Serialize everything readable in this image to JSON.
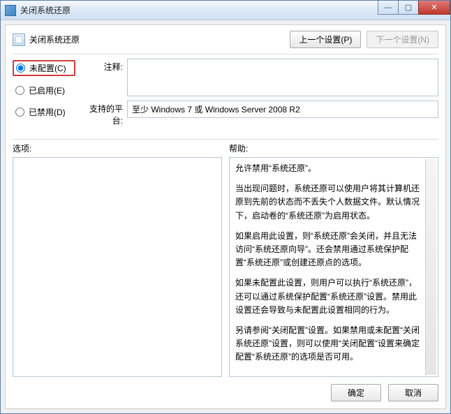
{
  "window_title": "关闭系统还原",
  "header": {
    "title": "关闭系统还原"
  },
  "nav": {
    "prev_label": "上一个设置(P)",
    "next_label": "下一个设置(N)"
  },
  "radios": {
    "not_configured": "未配置(C)",
    "enabled": "已启用(E)",
    "disabled": "已禁用(D)",
    "selected": "not_configured"
  },
  "fields": {
    "comment_label": "注释:",
    "comment_value": "",
    "platform_label": "支持的平台:",
    "platform_value": "至少 Windows 7 或 Windows Server 2008 R2"
  },
  "lower": {
    "options_label": "选项:",
    "help_label": "帮助:"
  },
  "help_text": {
    "p1": "允许禁用“系统还原”。",
    "p2": "当出现问题时，系统还原可以使用户将其计算机还原到先前的状态而不丢失个人数据文件。默认情况下，启动卷的“系统还原”为启用状态。",
    "p3": "如果启用此设置，则“系统还原”会关闭，并且无法访问“系统还原向导”。还会禁用通过系统保护配置“系统还原”或创建还原点的选项。",
    "p4": "如果未配置此设置，则用户可以执行“系统还原”，还可以通过系统保护配置“系统还原”设置。禁用此设置还会导致与未配置此设置相同的行为。",
    "p5": "另请参阅“关闭配置”设置。如果禁用或未配置“关闭系统还原”设置，则可以使用“关闭配置”设置来确定配置“系统还原”的选项是否可用。"
  },
  "footer": {
    "ok": "确定",
    "cancel": "取消"
  }
}
